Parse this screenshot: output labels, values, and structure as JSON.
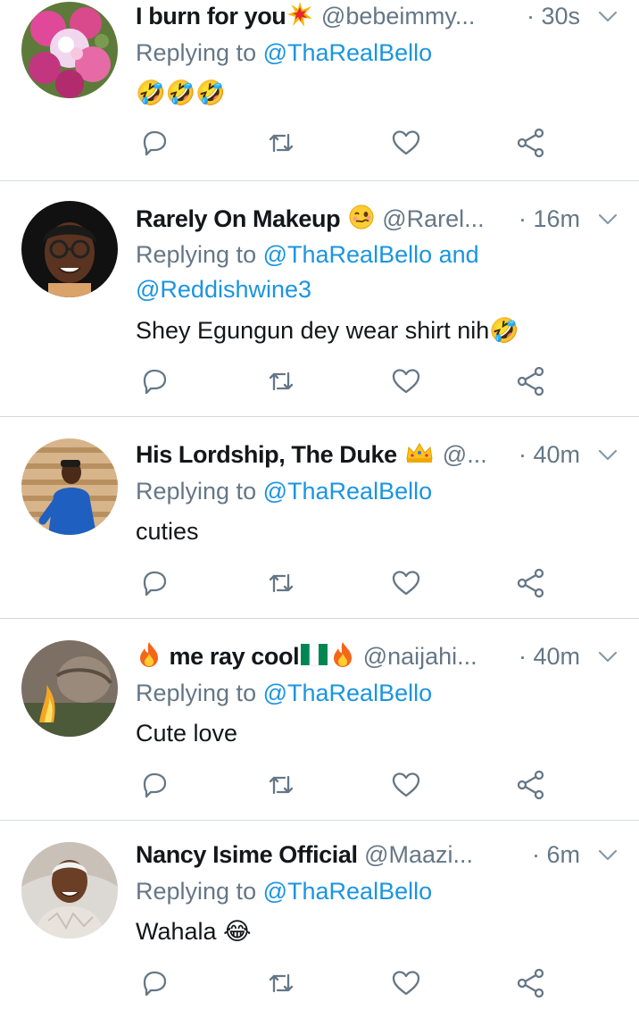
{
  "colors": {
    "link": "#1b95e0",
    "muted": "#657786",
    "text": "#14171a",
    "divider": "#d4d9de"
  },
  "icons": {
    "reply": "reply-icon",
    "retweet": "retweet-icon",
    "like": "heart-icon",
    "share": "share-icon",
    "menu": "chevron-down-icon"
  },
  "tweets": [
    {
      "name": "I burn for you",
      "handle": "@bebeimmy...",
      "time": "· 30s",
      "replying_prefix": "Replying to",
      "replying_to": "@ThaRealBello",
      "replying_extra": "",
      "replying_line2": "",
      "text": "🤣🤣🤣"
    },
    {
      "name": "Rarely On Makeup",
      "handle": "@Rarel...",
      "time": "· 16m",
      "replying_prefix": "Replying to",
      "replying_to": "@ThaRealBello",
      "replying_extra": "and",
      "replying_line2": "@Reddishwine3",
      "text": "Shey Egungun dey wear shirt nih🤣"
    },
    {
      "name": "His Lordship, The Duke",
      "handle": "@...",
      "time": "· 40m",
      "replying_prefix": "Replying to",
      "replying_to": "@ThaRealBello",
      "replying_extra": "",
      "replying_line2": "",
      "text": "cuties"
    },
    {
      "name": "me ray cool",
      "handle": "@naijahi...",
      "time": "· 40m",
      "replying_prefix": "Replying to",
      "replying_to": "@ThaRealBello",
      "replying_extra": "",
      "replying_line2": "",
      "text": "Cute love"
    },
    {
      "name": "Nancy Isime Official",
      "handle": "@Maazi...",
      "time": "· 6m",
      "replying_prefix": "Replying to",
      "replying_to": "@ThaRealBello",
      "replying_extra": "",
      "replying_line2": "",
      "text": "Wahala 😂"
    }
  ]
}
